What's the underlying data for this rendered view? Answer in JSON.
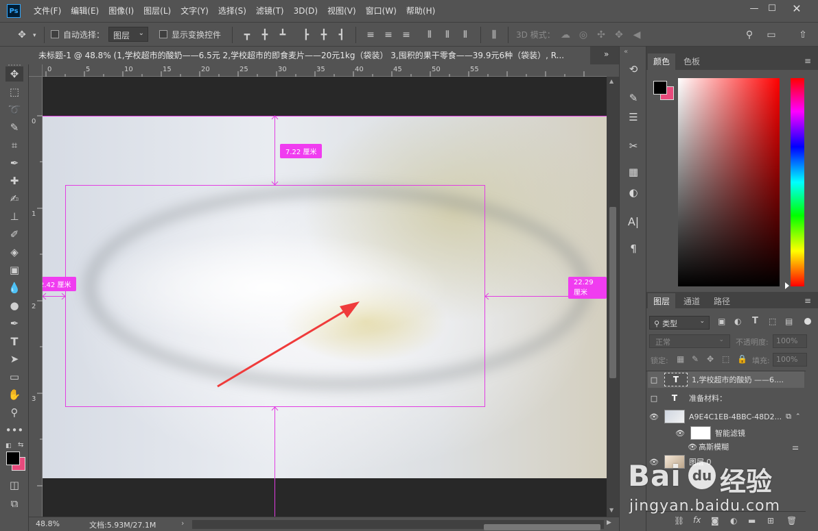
{
  "app": {
    "logo": "Ps"
  },
  "menu": [
    "文件(F)",
    "编辑(E)",
    "图像(I)",
    "图层(L)",
    "文字(Y)",
    "选择(S)",
    "滤镜(T)",
    "3D(D)",
    "视图(V)",
    "窗口(W)",
    "帮助(H)"
  ],
  "options": {
    "auto_select_label": "自动选择：",
    "layer_select": "图层",
    "show_transform_label": "显示变换控件",
    "mode_3d_label": "3D 模式："
  },
  "tab": {
    "title": "未标题-1 @ 48.8% (1,学校超市的酸奶——6.5元 2,学校超市的即食麦片——20元1kg（袋装） 3,囤积的果干零食——39.9元6种（袋装）, R..."
  },
  "ruler": {
    "top": [
      "0",
      "5",
      "10",
      "15",
      "20",
      "25",
      "30",
      "35",
      "40",
      "45",
      "50",
      "55"
    ],
    "left": [
      "0",
      "1",
      "2",
      "3"
    ]
  },
  "measure": {
    "top": "7.22 厘米",
    "left": "2.42 厘米",
    "right": "22.29 厘米"
  },
  "status": {
    "zoom": "48.8%",
    "doc": "文档:5.93M/27.1M"
  },
  "color_panel": {
    "tabs": [
      "颜色",
      "色板"
    ],
    "fg": "#000000",
    "bg": "#e84a7c"
  },
  "layers_panel": {
    "tabs": [
      "图层",
      "通道",
      "路径"
    ],
    "filter_kind": "类型",
    "blend_mode": "正常",
    "opacity_label": "不透明度:",
    "opacity": "100%",
    "lock_label": "锁定:",
    "fill_label": "填充:",
    "fill": "100%",
    "layers": [
      {
        "name": "1,学校超市的酸奶 ——6...."
      },
      {
        "name": "准备材料："
      },
      {
        "name": "A9E4C1EB-4BBC-48D2..."
      },
      {
        "name": "智能滤镜"
      },
      {
        "name": "高斯模糊"
      },
      {
        "name": "图层 0"
      }
    ]
  },
  "watermark": {
    "brand": "Bai",
    "brand2": "经验",
    "url": "jingyan.baidu.com"
  },
  "colors": {
    "guide": "#e23de2",
    "arrow": "#ef3b3b",
    "accent": "#31a8ff"
  }
}
